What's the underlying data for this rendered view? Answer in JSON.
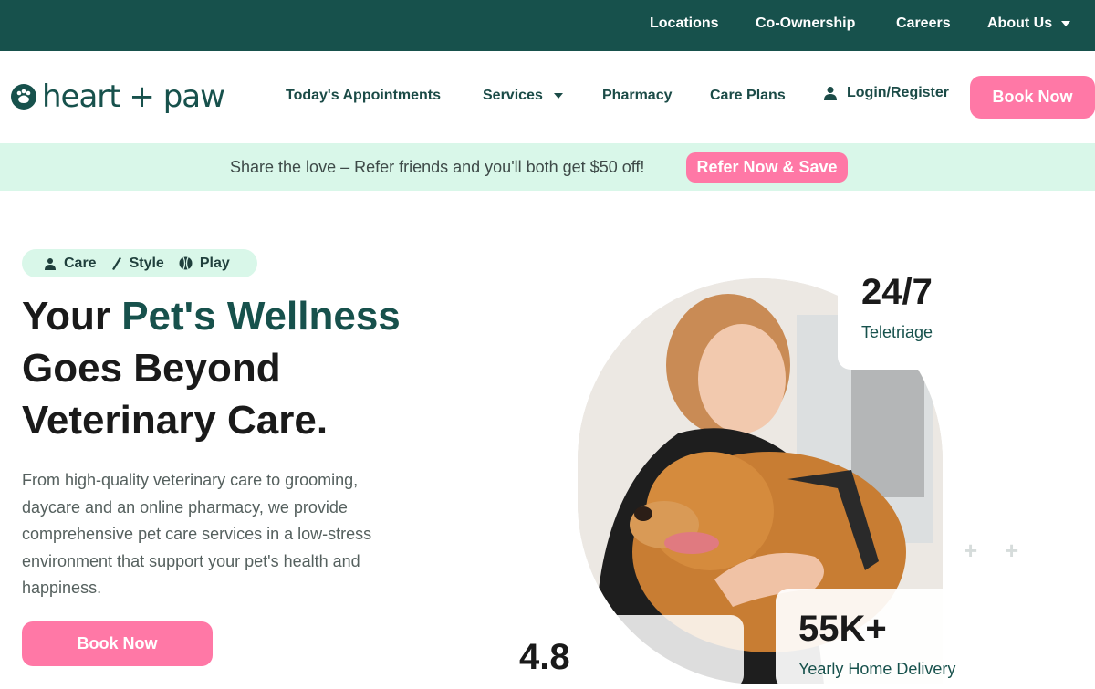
{
  "topbar": {
    "links": [
      "Locations",
      "Co-Ownership",
      "Careers",
      "About Us"
    ]
  },
  "nav": {
    "logo_text": "heart + paw",
    "items": [
      "Today's Appointments",
      "Services",
      "Pharmacy",
      "Care Plans"
    ],
    "login": "Login/Register",
    "book_now": "Book Now"
  },
  "promo": {
    "text": "Share the love – Refer friends and you'll both get $50 off!",
    "button": "Refer Now & Save"
  },
  "hero": {
    "tags": [
      "Care",
      "Style",
      "Play"
    ],
    "title_part1": "Your ",
    "title_accent": "Pet's Wellness",
    "title_part2": "Goes Beyond Veterinary Care.",
    "description": "From high-quality veterinary care to grooming, daycare and an online pharmacy, we provide comprehensive pet care services in a low-stress environment that support your pet's health and happiness.",
    "book_now": "Book Now"
  },
  "stats": [
    {
      "value": "24/7",
      "label": "Teletriage"
    },
    {
      "value": "4.8",
      "label": ""
    },
    {
      "value": "55K+",
      "label": "Yearly Home Delivery"
    }
  ],
  "colors": {
    "primary_green": "#17514c",
    "accent_pink": "#ff78a6",
    "mint": "#d9f7e9"
  }
}
